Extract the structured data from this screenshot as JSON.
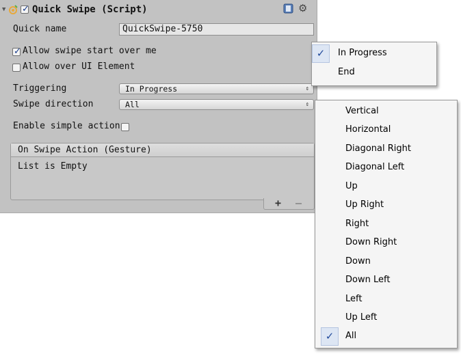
{
  "component": {
    "title": "Quick Swipe (Script)",
    "enabled": true,
    "icons": {
      "fold": "fold-arrow-icon",
      "script": "script-icon",
      "help": "help-book-icon",
      "settings": "gear-icon"
    }
  },
  "fields": {
    "quick_name_label": "Quick name",
    "quick_name_value": "QuickSwipe-5750",
    "allow_swipe_start_label": "Allow swipe start over me",
    "allow_swipe_start_checked": true,
    "allow_ui_label": "Allow over UI Element",
    "allow_ui_checked": false,
    "triggering_label": "Triggering",
    "triggering_value": "In Progress",
    "swipe_direction_label": "Swipe direction",
    "swipe_direction_value": "All",
    "simple_action_label": "Enable simple action",
    "simple_action_checked": false
  },
  "event": {
    "header": "On Swipe Action (Gesture)",
    "empty_text": "List is Empty",
    "add_label": "+",
    "remove_label": "–"
  },
  "triggering_menu": {
    "items": [
      {
        "label": "In Progress",
        "checked": true
      },
      {
        "label": "End",
        "checked": false
      }
    ]
  },
  "direction_menu": {
    "items": [
      {
        "label": "Vertical",
        "checked": false
      },
      {
        "label": "Horizontal",
        "checked": false
      },
      {
        "label": "Diagonal Right",
        "checked": false
      },
      {
        "label": "Diagonal Left",
        "checked": false
      },
      {
        "label": "Up",
        "checked": false
      },
      {
        "label": "Up Right",
        "checked": false
      },
      {
        "label": "Right",
        "checked": false
      },
      {
        "label": "Down Right",
        "checked": false
      },
      {
        "label": "Down",
        "checked": false
      },
      {
        "label": "Down Left",
        "checked": false
      },
      {
        "label": "Left",
        "checked": false
      },
      {
        "label": "Up Left",
        "checked": false
      },
      {
        "label": "All",
        "checked": true
      }
    ]
  },
  "colors": {
    "panel_bg": "#c2c2c2",
    "check_accent": "#244c9c",
    "menu_bg": "#f5f5f5"
  }
}
